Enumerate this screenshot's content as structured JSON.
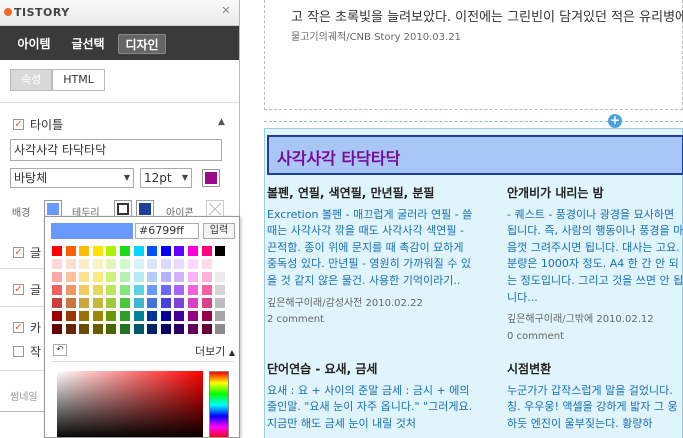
{
  "app": {
    "logo_text": "TISTORY",
    "tabs": [
      {
        "label": "아이템",
        "active": false
      },
      {
        "label": "글선택",
        "active": false
      },
      {
        "label": "디자인",
        "active": true
      }
    ],
    "subtabs": [
      {
        "label": "속성",
        "active": true
      },
      {
        "label": "HTML",
        "active": false
      }
    ]
  },
  "editor": {
    "title_section_label": "타이틀",
    "title_checked": true,
    "title_value": "사각사각 타닥타닥",
    "font_family": "바탕체",
    "font_size": "12pt",
    "font_color": "#9b0a8a",
    "bg_label": "배경",
    "border_label": "테두리",
    "icon_label": "아이콘",
    "bg_color": "#6799ff",
    "border_color": "#333333",
    "border_color_2": "#1f3d9b",
    "hidden_rows": [
      {
        "label": "글",
        "checked": true
      },
      {
        "label": "글",
        "checked": true
      },
      {
        "label": "카",
        "checked": true
      },
      {
        "label": "작",
        "checked": false
      }
    ],
    "footer_label": "썸네일"
  },
  "picker": {
    "current_color": "#6799ff",
    "hex_value": "#6799ff",
    "apply_label": "입력",
    "reset_icon": "undo-icon",
    "more_label": "더보기",
    "palette": [
      [
        "#ff0000",
        "#ff5e00",
        "#ffbb00",
        "#ffe400",
        "#abf200",
        "#1ddb16",
        "#00d8ff",
        "#0054ff",
        "#0100ff",
        "#5f00ff",
        "#ff00dd",
        "#ff007f",
        "#000000"
      ],
      [
        "#ffd8d8",
        "#fae0d4",
        "#faecc5",
        "#faf4c0",
        "#e4f7ba",
        "#ceFbc9",
        "#d4f4fa",
        "#d9e5ff",
        "#dad9ff",
        "#e8d9ff",
        "#ffd9fa",
        "#ffd9ec",
        "#ffffff"
      ],
      [
        "#ffa7a7",
        "#ffc19e",
        "#ffe08c",
        "#faed7d",
        "#cef279",
        "#b7f0b1",
        "#b2ebf4",
        "#b2ccff",
        "#b5b2ff",
        "#d1b2ff",
        "#ffb2f5",
        "#ffb2d9",
        "#eaeaea"
      ],
      [
        "#f15f5f",
        "#f29661",
        "#f2cb61",
        "#e5d85c",
        "#bce55c",
        "#86e57f",
        "#5cd1e5",
        "#6799ff",
        "#6b66ff",
        "#a566ff",
        "#f361dc",
        "#f361a6",
        "#d5d5d5"
      ],
      [
        "#cc3d3d",
        "#cc723d",
        "#cca63d",
        "#c4b73b",
        "#9fc93c",
        "#47c83e",
        "#3db7cc",
        "#4374d9",
        "#4641d9",
        "#8041d9",
        "#d941c5",
        "#d9418c",
        "#bdbdbd"
      ],
      [
        "#980000",
        "#993800",
        "#997000",
        "#998a00",
        "#6b9900",
        "#2f9d27",
        "#008299",
        "#003399",
        "#050099",
        "#3f0099",
        "#990085",
        "#99004c",
        "#a6a6a6"
      ],
      [
        "#670000",
        "#662500",
        "#664b00",
        "#665c00",
        "#476600",
        "#22741c",
        "#005766",
        "#002266",
        "#030066",
        "#2a0066",
        "#660058",
        "#660033",
        "#8c8c8c"
      ]
    ]
  },
  "blog": {
    "top_text": "고 작은 초록빛을 늘려보았다. 이전에는 그린빈이 담겨있던 적은 유리병에 화..",
    "top_meta": "물고기의궤적/CNB Story   2010.03.21",
    "widget_title": "사각사각 타닥타닥",
    "posts": [
      {
        "title": "볼펜, 연필, 색연필, 만년필, 분필",
        "body": "Excretion 볼펜 - 매끄럽게 굴러라 연필 - 쓸 때는 사각사각 깎을 때도 사각사각 색연필 - 끈적함. 종이 위에 문지를 때 촉감이 묘하게 중독성 있다. 만년필 - 영원히 가까워질 수 있을 것 같지 않은 물건. 사용한 기억이라기..",
        "meta": "깊은해구이래/감성사전   2010.02.22",
        "comments": "2 comment"
      },
      {
        "title": "안개비가 내리는 밤",
        "body": "- 퀘스트 - 풍경이나 광경을 묘사하면 됩니다. 즉, 사람의 행동이나 풍경을 마음껏 그려주시면 됩니다. 대사는 고요. 분량은 1000자 정도. A4 한 간 안 되는 정도입니다. 그리고 것을 쓰면 안 됩니다...",
        "meta": "깊은해구이래/그밖에   2010.02.12",
        "comments": "0 comment"
      },
      {
        "title": "단어연습 - 요새, 금세",
        "body": "요새 : 요 + 사이의 준말 금세 : 금시 + 에의 줄인말. \"요새 눈이 자주 옵니다.\" \"그러게요. 지금만 해도 금세 눈이 내릴 것처",
        "meta": "",
        "comments": ""
      },
      {
        "title": "시점변환",
        "body": "누군가가 갑작스럽게 말을 걸었니다. 칭. 우우웅! 액셀을 강하게 밟자 그 웅하듯 엔진이 울부짖는다. 황량하",
        "meta": "",
        "comments": ""
      }
    ]
  }
}
